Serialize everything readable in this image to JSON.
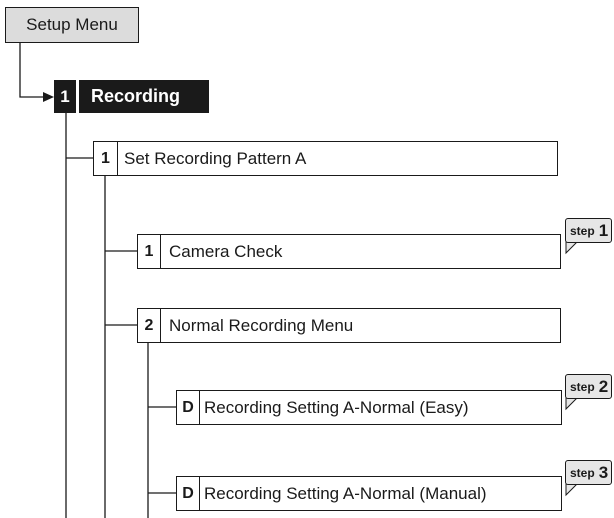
{
  "setup_menu": {
    "label": "Setup Menu"
  },
  "recording": {
    "number": "1",
    "label": "Recording"
  },
  "pattern": {
    "number": "1",
    "label": "Set Recording Pattern A"
  },
  "camera_check": {
    "number": "1",
    "label": "Camera Check"
  },
  "normal_menu": {
    "number": "2",
    "label": "Normal Recording Menu"
  },
  "setting_easy": {
    "number": "D",
    "label": "Recording Setting A-Normal (Easy)"
  },
  "setting_manual": {
    "number": "D",
    "label": "Recording Setting A-Normal (Manual)"
  },
  "steps": [
    {
      "word": "step",
      "number": "1"
    },
    {
      "word": "step",
      "number": "2"
    },
    {
      "word": "step",
      "number": "3"
    }
  ]
}
